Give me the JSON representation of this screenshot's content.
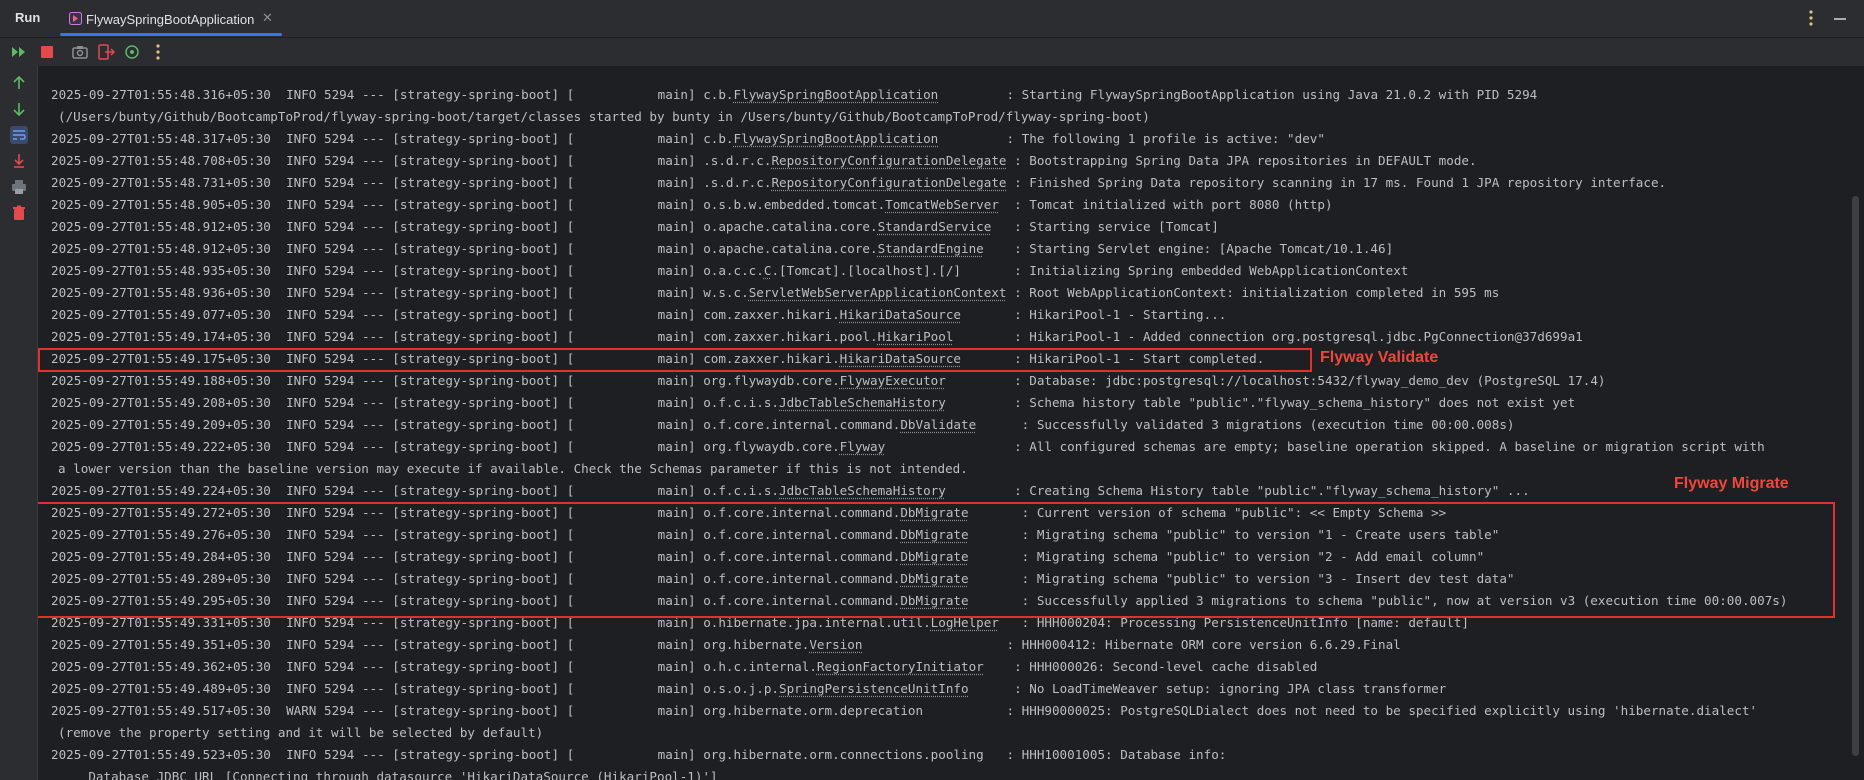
{
  "top": {
    "run_label": "Run",
    "tab_label": "FlywaySpringBootApplication",
    "tab_close": "✕"
  },
  "annotations": {
    "validate": "Flyway Validate",
    "migrate": "Flyway Migrate"
  },
  "colors": {
    "accent": "#3574f0",
    "highlight": "#e0312c",
    "annotation": "#f0473c",
    "rerun_green": "#5fb865",
    "stop_red": "#e5484d"
  },
  "log": [
    {
      "ts": "2025-09-27T01:55:48.316+05:30",
      "level": "INFO",
      "pid": "5294",
      "app": "[strategy-spring-boot]",
      "thread": "[           main]",
      "logger_pre": "c.b.",
      "logger_u": "FlywaySpringBootApplication",
      "logger_pad": "         ",
      "msg": ": Starting FlywaySpringBootApplication using Java 21.0.2 with PID 5294"
    },
    {
      "cont": "(/Users/bunty/Github/BootcampToProd/flyway-spring-boot/target/classes started by bunty in /Users/bunty/Github/BootcampToProd/flyway-spring-boot)"
    },
    {
      "ts": "2025-09-27T01:55:48.317+05:30",
      "level": "INFO",
      "pid": "5294",
      "app": "[strategy-spring-boot]",
      "thread": "[           main]",
      "logger_pre": "c.b.",
      "logger_u": "FlywaySpringBootApplication",
      "logger_pad": "         ",
      "msg": ": The following 1 profile is active: \"dev\""
    },
    {
      "ts": "2025-09-27T01:55:48.708+05:30",
      "level": "INFO",
      "pid": "5294",
      "app": "[strategy-spring-boot]",
      "thread": "[           main]",
      "logger_pre": ".s.d.r.c.",
      "logger_u": "RepositoryConfigurationDelegate",
      "logger_pad": " ",
      "msg": ": Bootstrapping Spring Data JPA repositories in DEFAULT mode."
    },
    {
      "ts": "2025-09-27T01:55:48.731+05:30",
      "level": "INFO",
      "pid": "5294",
      "app": "[strategy-spring-boot]",
      "thread": "[           main]",
      "logger_pre": ".s.d.r.c.",
      "logger_u": "RepositoryConfigurationDelegate",
      "logger_pad": " ",
      "msg": ": Finished Spring Data repository scanning in 17 ms. Found 1 JPA repository interface."
    },
    {
      "ts": "2025-09-27T01:55:48.905+05:30",
      "level": "INFO",
      "pid": "5294",
      "app": "[strategy-spring-boot]",
      "thread": "[           main]",
      "logger_pre": "o.s.b.w.embedded.tomcat.",
      "logger_u": "TomcatWebServer",
      "logger_pad": "  ",
      "msg": ": Tomcat initialized with port 8080 (http)"
    },
    {
      "ts": "2025-09-27T01:55:48.912+05:30",
      "level": "INFO",
      "pid": "5294",
      "app": "[strategy-spring-boot]",
      "thread": "[           main]",
      "logger_pre": "o.apache.catalina.core.",
      "logger_u": "StandardService",
      "logger_pad": "   ",
      "msg": ": Starting service [Tomcat]"
    },
    {
      "ts": "2025-09-27T01:55:48.912+05:30",
      "level": "INFO",
      "pid": "5294",
      "app": "[strategy-spring-boot]",
      "thread": "[           main]",
      "logger_pre": "o.apache.catalina.core.",
      "logger_u": "StandardEngine",
      "logger_pad": "    ",
      "msg": ": Starting Servlet engine: [Apache Tomcat/10.1.46]"
    },
    {
      "ts": "2025-09-27T01:55:48.935+05:30",
      "level": "INFO",
      "pid": "5294",
      "app": "[strategy-spring-boot]",
      "thread": "[           main]",
      "logger_pre": "o.a.c.c.",
      "logger_u": "C",
      "logger_post": ".[Tomcat].[localhost].[/]",
      "logger_pad": "       ",
      "msg": ": Initializing Spring embedded WebApplicationContext"
    },
    {
      "ts": "2025-09-27T01:55:48.936+05:30",
      "level": "INFO",
      "pid": "5294",
      "app": "[strategy-spring-boot]",
      "thread": "[           main]",
      "logger_pre": "w.s.c.",
      "logger_u": "ServletWebServerApplicationContext",
      "logger_pad": " ",
      "msg": ": Root WebApplicationContext: initialization completed in 595 ms"
    },
    {
      "ts": "2025-09-27T01:55:49.077+05:30",
      "level": "INFO",
      "pid": "5294",
      "app": "[strategy-spring-boot]",
      "thread": "[           main]",
      "logger_pre": "com.zaxxer.hikari.",
      "logger_u": "HikariDataSource",
      "logger_pad": "       ",
      "msg": ": HikariPool-1 - Starting..."
    },
    {
      "ts": "2025-09-27T01:55:49.174+05:30",
      "level": "INFO",
      "pid": "5294",
      "app": "[strategy-spring-boot]",
      "thread": "[           main]",
      "logger_pre": "com.zaxxer.hikari.pool.",
      "logger_u": "HikariPool",
      "logger_pad": "        ",
      "msg": ": HikariPool-1 - Added connection org.postgresql.jdbc.PgConnection@37d699a1"
    },
    {
      "ts": "2025-09-27T01:55:49.175+05:30",
      "level": "INFO",
      "pid": "5294",
      "app": "[strategy-spring-boot]",
      "thread": "[           main]",
      "logger_pre": "com.zaxxer.hikari.",
      "logger_u": "HikariDataSource",
      "logger_pad": "       ",
      "msg": ": HikariPool-1 - Start completed."
    },
    {
      "ts": "2025-09-27T01:55:49.188+05:30",
      "level": "INFO",
      "pid": "5294",
      "app": "[strategy-spring-boot]",
      "thread": "[           main]",
      "logger_pre": "org.flywaydb.core.",
      "logger_u": "FlywayExecutor",
      "logger_pad": "         ",
      "msg": ": Database: jdbc:postgresql://localhost:5432/flyway_demo_dev (PostgreSQL 17.4)"
    },
    {
      "ts": "2025-09-27T01:55:49.208+05:30",
      "level": "INFO",
      "pid": "5294",
      "app": "[strategy-spring-boot]",
      "thread": "[           main]",
      "logger_pre": "o.f.c.i.s.",
      "logger_u": "JdbcTableSchemaHistory",
      "logger_pad": "         ",
      "msg": ": Schema history table \"public\".\"flyway_schema_history\" does not exist yet"
    },
    {
      "ts": "2025-09-27T01:55:49.209+05:30",
      "level": "INFO",
      "pid": "5294",
      "app": "[strategy-spring-boot]",
      "thread": "[           main]",
      "logger_pre": "o.f.core.internal.command.",
      "logger_u": "DbValidate",
      "logger_pad": "      ",
      "msg": ": Successfully validated 3 migrations (execution time 00:00.008s)"
    },
    {
      "ts": "2025-09-27T01:55:49.222+05:30",
      "level": "INFO",
      "pid": "5294",
      "app": "[strategy-spring-boot]",
      "thread": "[           main]",
      "logger_pre": "org.flywaydb.core.",
      "logger_u": "Flyway",
      "logger_pad": "                 ",
      "msg": ": All configured schemas are empty; baseline operation skipped. A baseline or migration script with"
    },
    {
      "cont": "a lower version than the baseline version may execute if available. Check the Schemas parameter if this is not intended."
    },
    {
      "ts": "2025-09-27T01:55:49.224+05:30",
      "level": "INFO",
      "pid": "5294",
      "app": "[strategy-spring-boot]",
      "thread": "[           main]",
      "logger_pre": "o.f.c.i.s.",
      "logger_u": "JdbcTableSchemaHistory",
      "logger_pad": "         ",
      "msg": ": Creating Schema History table \"public\".\"flyway_schema_history\" ..."
    },
    {
      "ts": "2025-09-27T01:55:49.272+05:30",
      "level": "INFO",
      "pid": "5294",
      "app": "[strategy-spring-boot]",
      "thread": "[           main]",
      "logger_pre": "o.f.core.internal.command.",
      "logger_u": "DbMigrate",
      "logger_pad": "       ",
      "msg": ": Current version of schema \"public\": << Empty Schema >>"
    },
    {
      "ts": "2025-09-27T01:55:49.276+05:30",
      "level": "INFO",
      "pid": "5294",
      "app": "[strategy-spring-boot]",
      "thread": "[           main]",
      "logger_pre": "o.f.core.internal.command.",
      "logger_u": "DbMigrate",
      "logger_pad": "       ",
      "msg": ": Migrating schema \"public\" to version \"1 - Create users table\""
    },
    {
      "ts": "2025-09-27T01:55:49.284+05:30",
      "level": "INFO",
      "pid": "5294",
      "app": "[strategy-spring-boot]",
      "thread": "[           main]",
      "logger_pre": "o.f.core.internal.command.",
      "logger_u": "DbMigrate",
      "logger_pad": "       ",
      "msg": ": Migrating schema \"public\" to version \"2 - Add email column\""
    },
    {
      "ts": "2025-09-27T01:55:49.289+05:30",
      "level": "INFO",
      "pid": "5294",
      "app": "[strategy-spring-boot]",
      "thread": "[           main]",
      "logger_pre": "o.f.core.internal.command.",
      "logger_u": "DbMigrate",
      "logger_pad": "       ",
      "msg": ": Migrating schema \"public\" to version \"3 - Insert dev test data\""
    },
    {
      "ts": "2025-09-27T01:55:49.295+05:30",
      "level": "INFO",
      "pid": "5294",
      "app": "[strategy-spring-boot]",
      "thread": "[           main]",
      "logger_pre": "o.f.core.internal.command.",
      "logger_u": "DbMigrate",
      "logger_pad": "       ",
      "msg": ": Successfully applied 3 migrations to schema \"public\", now at version v3 (execution time 00:00.007s)"
    },
    {
      "ts": "2025-09-27T01:55:49.331+05:30",
      "level": "INFO",
      "pid": "5294",
      "app": "[strategy-spring-boot]",
      "thread": "[           main]",
      "logger_pre": "o.hibernate.jpa.internal.util.",
      "logger_u": "LogHelper",
      "logger_pad": "   ",
      "msg": ": HHH000204: Processing PersistenceUnitInfo [name: default]"
    },
    {
      "ts": "2025-09-27T01:55:49.351+05:30",
      "level": "INFO",
      "pid": "5294",
      "app": "[strategy-spring-boot]",
      "thread": "[           main]",
      "logger_pre": "org.hibernate.",
      "logger_u": "Version",
      "logger_pad": "                   ",
      "msg": ": HHH000412: Hibernate ORM core version 6.6.29.Final"
    },
    {
      "ts": "2025-09-27T01:55:49.362+05:30",
      "level": "INFO",
      "pid": "5294",
      "app": "[strategy-spring-boot]",
      "thread": "[           main]",
      "logger_pre": "o.h.c.internal.",
      "logger_u": "RegionFactoryInitiator",
      "logger_pad": "    ",
      "msg": ": HHH000026: Second-level cache disabled"
    },
    {
      "ts": "2025-09-27T01:55:49.489+05:30",
      "level": "INFO",
      "pid": "5294",
      "app": "[strategy-spring-boot]",
      "thread": "[           main]",
      "logger_pre": "o.s.o.j.p.",
      "logger_u": "SpringPersistenceUnitInfo",
      "logger_pad": "      ",
      "msg": ": No LoadTimeWeaver setup: ignoring JPA class transformer"
    },
    {
      "ts": "2025-09-27T01:55:49.517+05:30",
      "level": "WARN",
      "pid": "5294",
      "app": "[strategy-spring-boot]",
      "thread": "[           main]",
      "logger_pre": "org.hibernate.orm.deprecation",
      "logger_u": "",
      "logger_pad": "           ",
      "msg": ": HHH90000025: PostgreSQLDialect does not need to be specified explicitly using 'hibernate.dialect'"
    },
    {
      "cont": "(remove the property setting and it will be selected by default)"
    },
    {
      "ts": "2025-09-27T01:55:49.523+05:30",
      "level": "INFO",
      "pid": "5294",
      "app": "[strategy-spring-boot]",
      "thread": "[           main]",
      "logger_pre": "org.hibernate.orm.connections.pooling",
      "logger_u": "",
      "logger_pad": "   ",
      "msg": ": HHH10001005: Database info:"
    },
    {
      "cont": "    Database JDBC URL [Connecting through datasource 'HikariDataSource (HikariPool-1)']"
    }
  ]
}
